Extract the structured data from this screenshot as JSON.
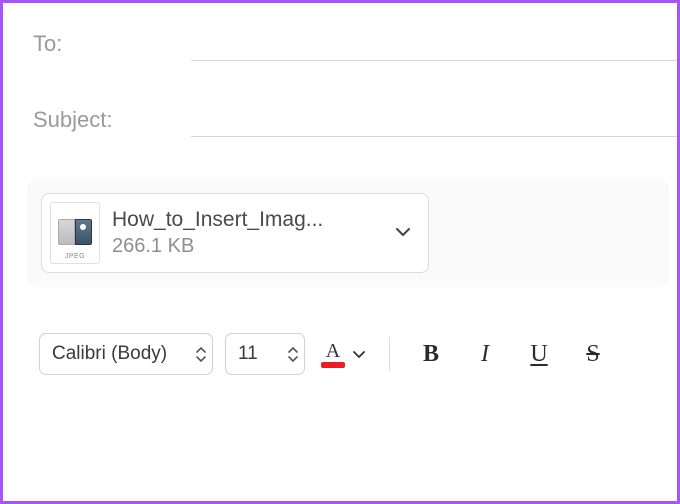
{
  "fields": {
    "to_label": "To:",
    "to_value": "",
    "subject_label": "Subject:",
    "subject_value": ""
  },
  "attachment": {
    "filename_display": "How_to_Insert_Imag...",
    "size": "266.1 KB",
    "type_label": "JPEG"
  },
  "toolbar": {
    "font_name": "Calibri (Body)",
    "font_size": "11",
    "font_color_letter": "A",
    "font_color_swatch": "#ed1c24",
    "bold": "B",
    "italic": "I",
    "underline": "U",
    "strike": "S"
  }
}
